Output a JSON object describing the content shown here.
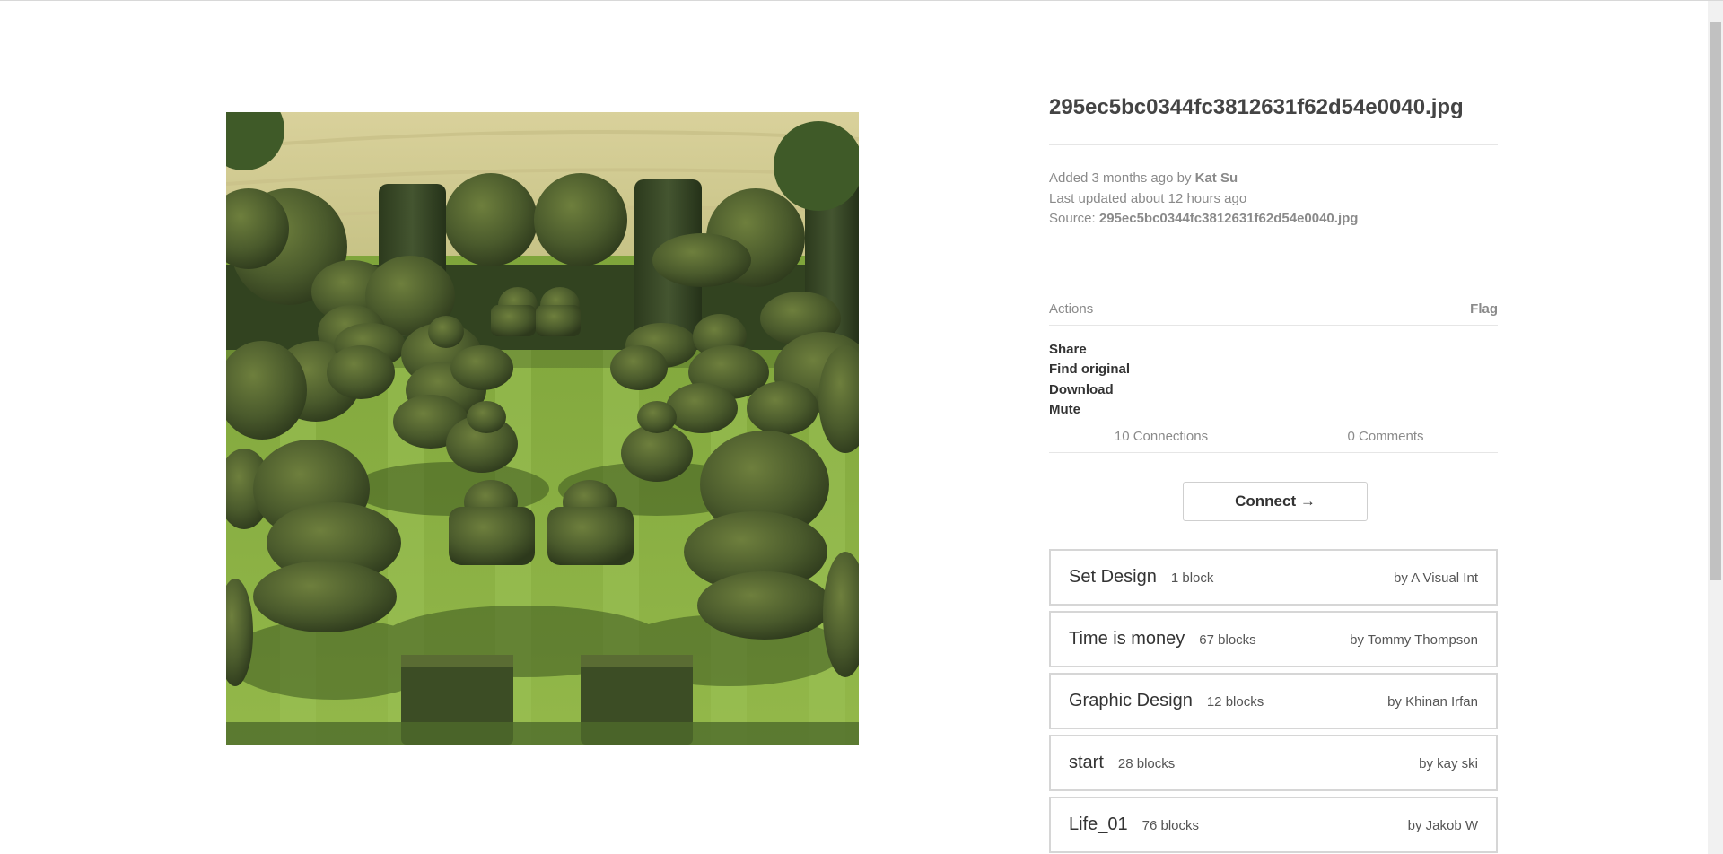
{
  "block": {
    "title": "295ec5bc0344fc3812631f62d54e0040.jpg",
    "image_alt": "Topiary garden with clipped yew shapes on a striped lawn"
  },
  "info": {
    "added_prefix": "Added 3 months ago by ",
    "added_by": "Kat Su",
    "updated": "Last updated about 12 hours ago",
    "source_prefix": "Source: ",
    "source": "295ec5bc0344fc3812631f62d54e0040.jpg"
  },
  "actions": {
    "header": "Actions",
    "flag": "Flag",
    "items": [
      "Share",
      "Find original",
      "Download",
      "Mute"
    ]
  },
  "tabs": {
    "connections": "10 Connections",
    "comments": "0 Comments"
  },
  "connect": {
    "label": "Connect →"
  },
  "channels": [
    {
      "name": "Set Design",
      "count": "1 block",
      "owner": "by A Visual Int"
    },
    {
      "name": "Time is money",
      "count": "67 blocks",
      "owner": "by Tommy Thompson"
    },
    {
      "name": "Graphic Design",
      "count": "12 blocks",
      "owner": "by Khinan Irfan"
    },
    {
      "name": "start",
      "count": "28 blocks",
      "owner": "by kay ski"
    },
    {
      "name": "Life_01",
      "count": "76 blocks",
      "owner": "by Jakob W"
    }
  ],
  "colors": {
    "lawn": "#8db046",
    "hedge_dark": "#3a4a26",
    "hedge_light": "#6b7c3c",
    "field": "#d8cf9a"
  }
}
